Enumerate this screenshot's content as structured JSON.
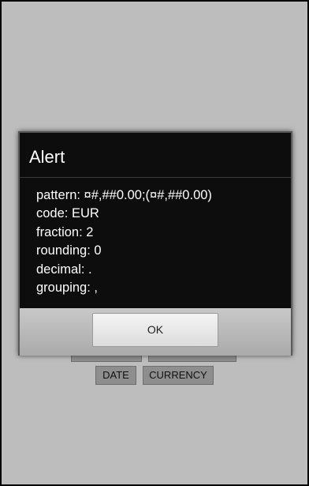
{
  "alert": {
    "title": "Alert",
    "message_lines": [
      "pattern: ¤#,##0.00;(¤#,##0.00)",
      "code: EUR",
      "fraction: 2",
      "rounding: 0",
      "decimal: .",
      "grouping: ,"
    ],
    "ok_label": "OK"
  },
  "background": {
    "buttons": [
      "DATE",
      "CURRENCY"
    ]
  }
}
